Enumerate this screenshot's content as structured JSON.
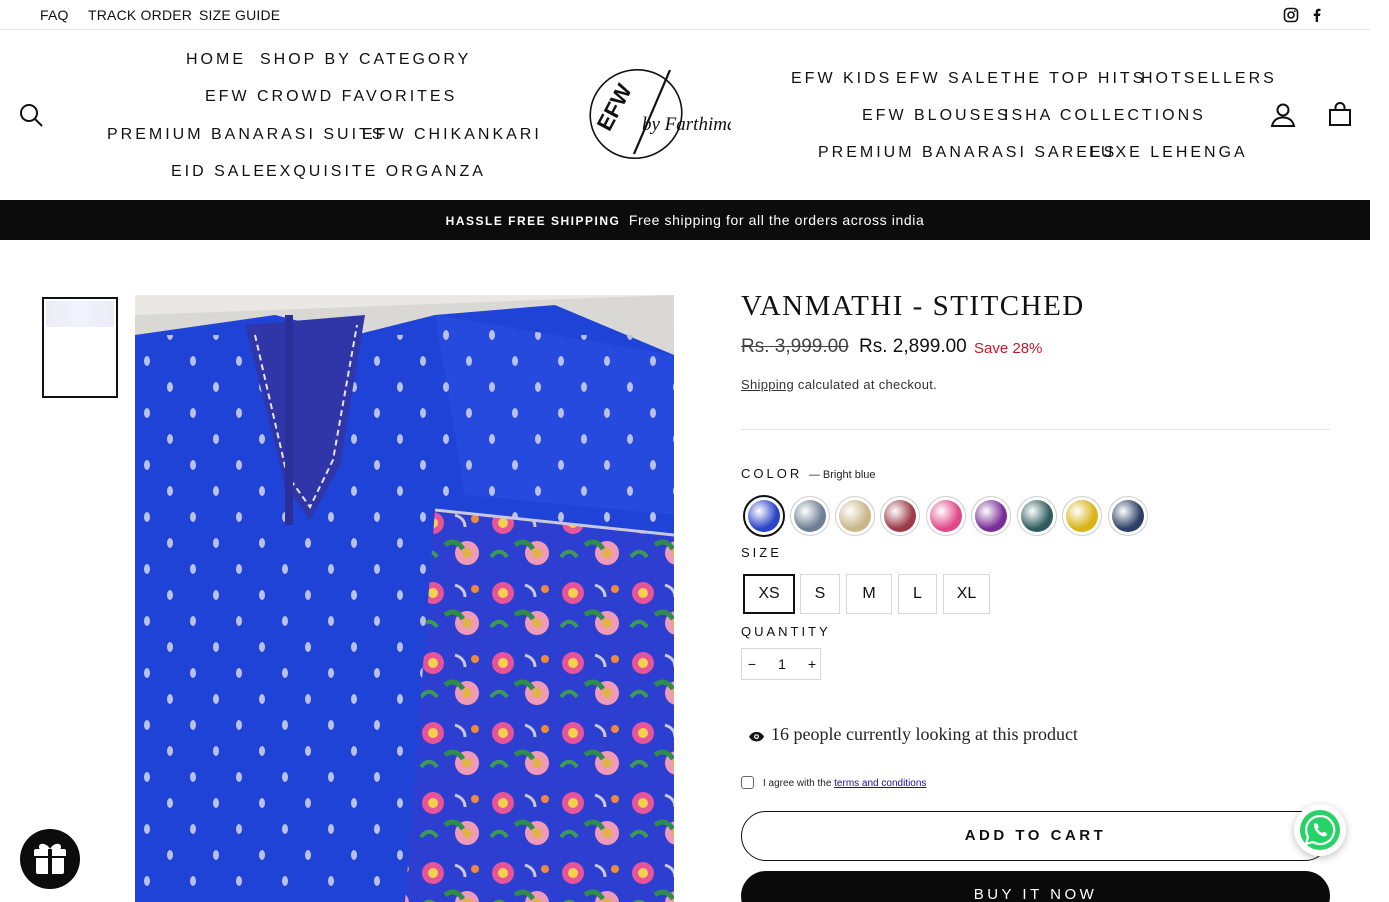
{
  "utility": {
    "links": [
      "FAQ",
      "TRACK ORDER",
      "SIZE GUIDE"
    ],
    "social_icons": [
      "instagram-icon",
      "facebook-icon"
    ]
  },
  "nav_left": {
    "row1": [
      "HOME",
      "SHOP BY CATEGORY"
    ],
    "row2": [
      "EFW CROWD FAVORITES"
    ],
    "row3": [
      "PREMIUM BANARASI SUITS",
      "EFW CHIKANKARI"
    ],
    "row4": [
      "EID SALE",
      "EXQUISITE ORGANZA"
    ]
  },
  "nav_right": {
    "row1": [
      "EFW KIDS",
      "EFW SALE",
      "THE TOP HITS",
      "HOTSELLERS"
    ],
    "row2": [
      "EFW BLOUSES",
      "ISHA COLLECTIONS"
    ],
    "row3": [
      "PREMIUM BANARASI SAREES",
      "LUXE LEHENGA"
    ]
  },
  "header_icons": [
    "search-icon",
    "user-icon",
    "cart-icon"
  ],
  "logo": {
    "text_main": "EFW",
    "text_script": "by Farthima"
  },
  "announcement": {
    "bold": "HASSLE FREE SHIPPING",
    "text": "Free shipping for all the orders across india"
  },
  "product": {
    "title": "VANMATHI - STITCHED",
    "price_compare": "Rs. 3,999.00",
    "price": "Rs. 2,899.00",
    "save": "Save 28%",
    "shipping_link": "Shipping",
    "shipping_text": "calculated at checkout.",
    "color_label": "COLOR",
    "color_value": "— Bright blue",
    "size_label": "SIZE",
    "sizes": [
      "XS",
      "S",
      "M",
      "L",
      "XL"
    ],
    "selected_size": "XS",
    "quantity_label": "QUANTITY",
    "quantity": "1",
    "qty_minus": "−",
    "qty_plus": "+",
    "viewers_text": "16 people currently looking at this product",
    "agree_text": "I agree with the",
    "terms_link": "terms and conditions",
    "add_to_cart": "ADD TO CART",
    "buy_now": "BUY IT NOW"
  },
  "swatches": [
    {
      "name": "Bright blue",
      "color": "#2a44c8",
      "selected": true
    },
    {
      "name": "grey",
      "color": "#6f7f94"
    },
    {
      "name": "beige",
      "color": "#c9b78a"
    },
    {
      "name": "maroon",
      "color": "#9c3a48"
    },
    {
      "name": "pink",
      "color": "#e0498a"
    },
    {
      "name": "purple",
      "color": "#7a2f98"
    },
    {
      "name": "teal",
      "color": "#2f5d5e"
    },
    {
      "name": "yellow",
      "color": "#d9b414"
    },
    {
      "name": "navy",
      "color": "#2c3f66"
    }
  ],
  "colors": {
    "accent_save": "#c7182b",
    "announce_bg": "#0c0c0c",
    "fabric_blue": "#1f43d6"
  }
}
